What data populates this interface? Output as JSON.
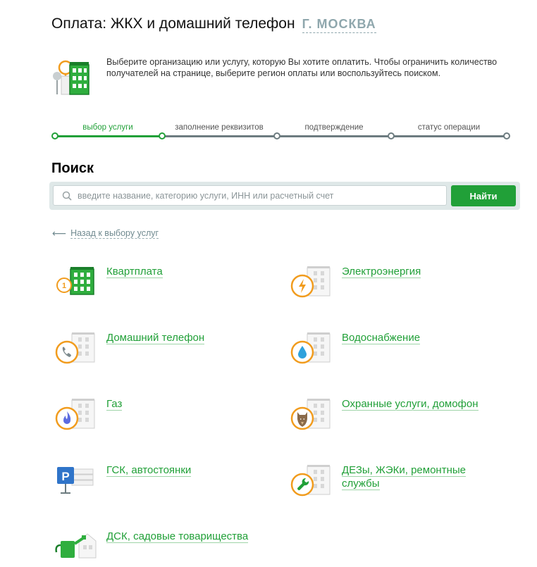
{
  "header": {
    "title": "Оплата: ЖКХ и домашний телефон",
    "region": "Г. МОСКВА"
  },
  "intro": {
    "text": "Выберите организацию или услугу, которую Вы хотите оплатить. Чтобы ограничить количество получателей на странице, выберите регион оплаты или воспользуйтесь поиском."
  },
  "steps": [
    {
      "label": "выбор услуги",
      "state": "active"
    },
    {
      "label": "заполнение реквизитов",
      "state": "pending"
    },
    {
      "label": "подтверждение",
      "state": "pending"
    },
    {
      "label": "статус операции",
      "state": "pending"
    }
  ],
  "search": {
    "heading": "Поиск",
    "placeholder": "введите название, категорию услуги, ИНН или расчетный счет",
    "value": "",
    "button_label": "Найти"
  },
  "back": {
    "label": "Назад к выбору услуг"
  },
  "services": [
    {
      "label": "Квартплата",
      "icon": "apartment-rent-icon"
    },
    {
      "label": "Электроэнергия",
      "icon": "electricity-icon"
    },
    {
      "label": "Домашний телефон",
      "icon": "home-phone-icon"
    },
    {
      "label": "Водоснабжение",
      "icon": "water-supply-icon"
    },
    {
      "label": "Газ",
      "icon": "gas-icon"
    },
    {
      "label": "Охранные услуги, домофон",
      "icon": "security-service-icon"
    },
    {
      "label": "ГСК, автостоянки",
      "icon": "parking-icon"
    },
    {
      "label": "ДЕЗы, ЖЭКи, ремонтные службы",
      "icon": "repair-service-icon"
    },
    {
      "label": "ДСК, садовые товарищества",
      "icon": "garden-cooperative-icon"
    }
  ],
  "colors": {
    "accent": "#21a038",
    "badge": "#f19c1e",
    "muted": "#8fa7ad"
  }
}
